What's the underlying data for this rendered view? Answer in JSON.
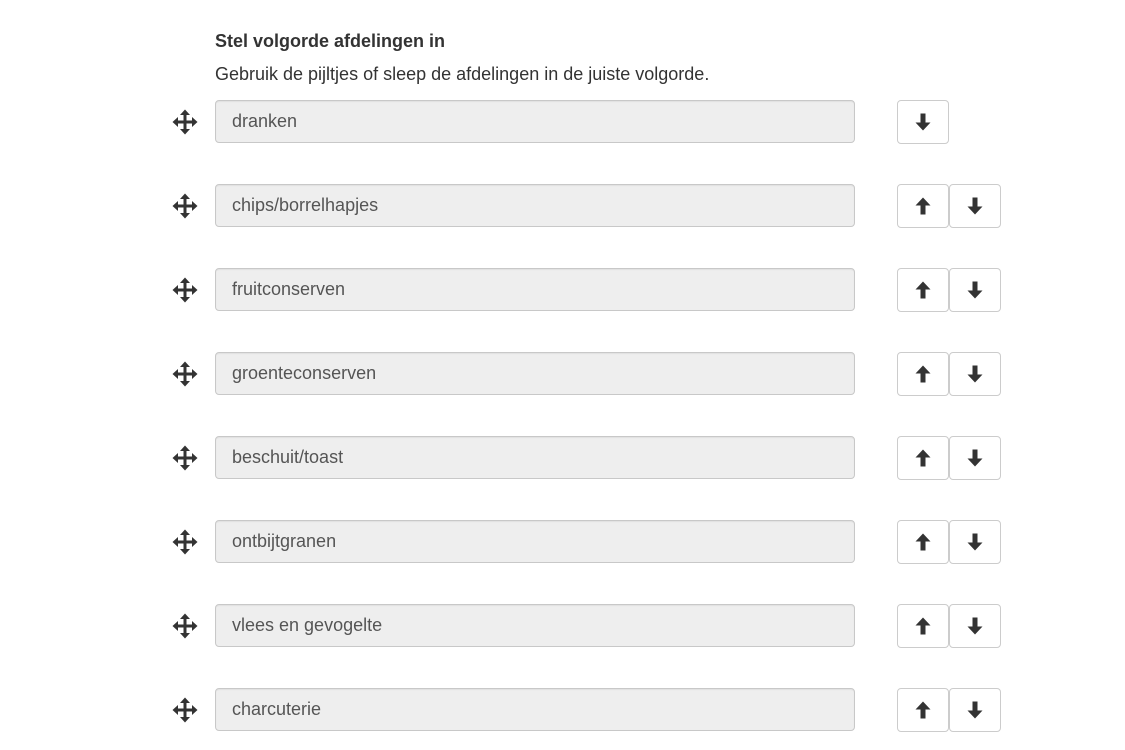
{
  "header": {
    "title": "Stel volgorde afdelingen in",
    "instruction": "Gebruik de pijltjes of sleep de afdelingen in de juiste volgorde."
  },
  "departments": [
    {
      "label": "dranken",
      "can_move_up": false,
      "can_move_down": true
    },
    {
      "label": "chips/borrelhapjes",
      "can_move_up": true,
      "can_move_down": true
    },
    {
      "label": "fruitconserven",
      "can_move_up": true,
      "can_move_down": true
    },
    {
      "label": "groenteconserven",
      "can_move_up": true,
      "can_move_down": true
    },
    {
      "label": "beschuit/toast",
      "can_move_up": true,
      "can_move_down": true
    },
    {
      "label": "ontbijtgranen",
      "can_move_up": true,
      "can_move_down": true
    },
    {
      "label": "vlees en gevogelte",
      "can_move_up": true,
      "can_move_down": true
    },
    {
      "label": "charcuterie",
      "can_move_up": true,
      "can_move_down": true
    }
  ],
  "icons": {
    "drag": "move-arrows-icon",
    "up": "arrow-up-icon",
    "down": "arrow-down-icon"
  },
  "colors": {
    "text": "#333333",
    "field_background": "#eeeeee",
    "field_border": "#c8c8c8",
    "button_border": "#cccccc",
    "icon": "#333333"
  }
}
